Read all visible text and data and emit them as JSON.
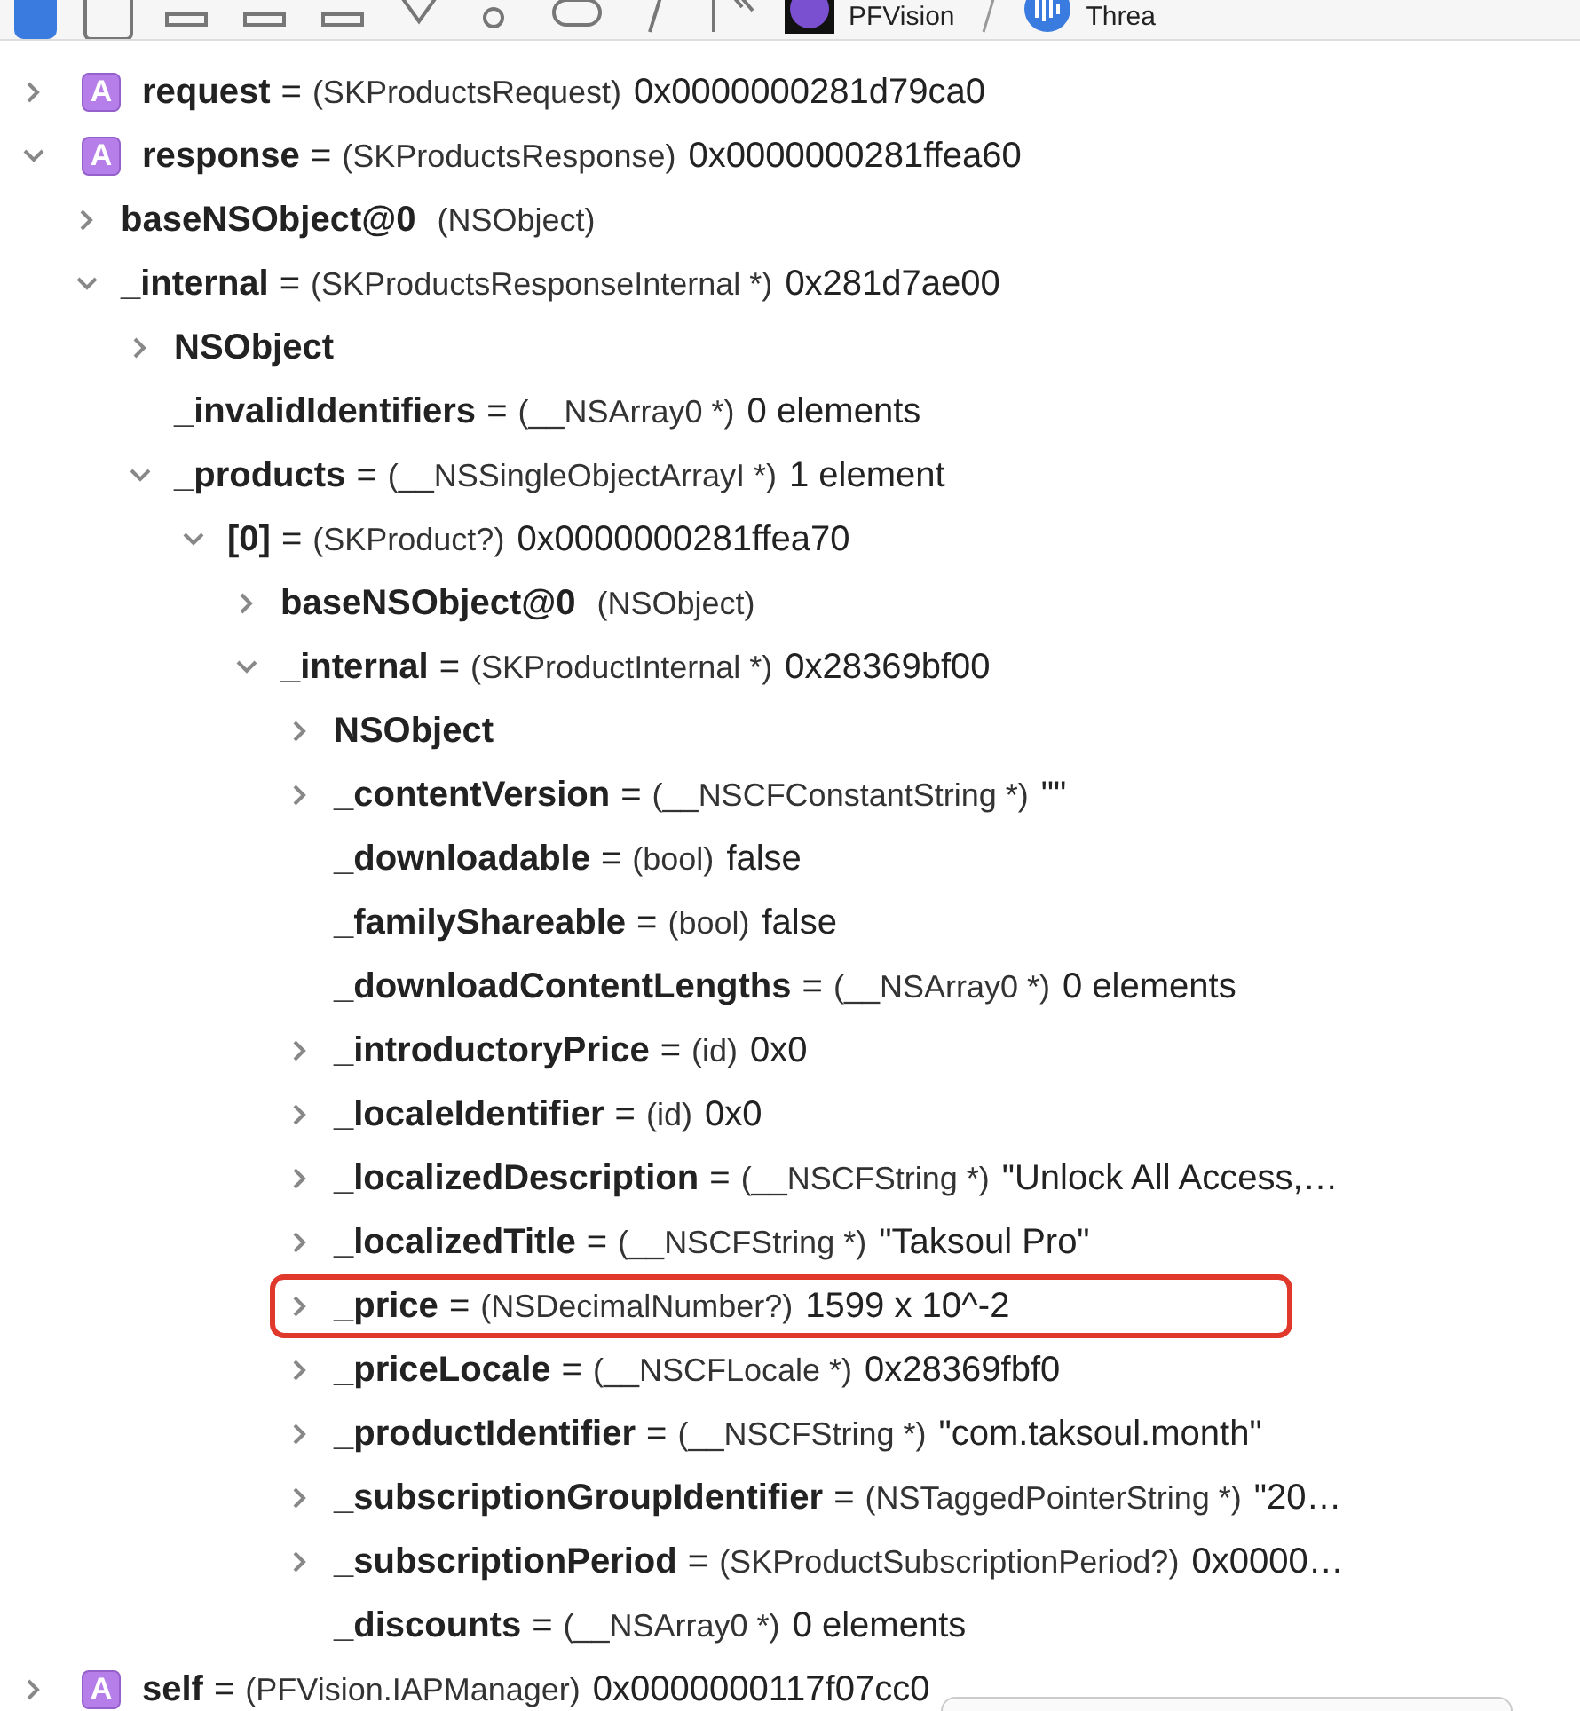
{
  "toolbar": {
    "breadcrumbs": [
      {
        "label": "PFVision"
      },
      {
        "label": "Threa"
      }
    ]
  },
  "variables": [
    {
      "kind": "group",
      "expanded": false,
      "highlighted": false,
      "badge": "A",
      "name": "request",
      "equals": "=",
      "type": "(SKProductsRequest)",
      "value": "0x0000000281d79ca0"
    },
    {
      "kind": "group",
      "expanded": true,
      "highlighted": false,
      "badge": "A",
      "name": "response",
      "equals": "=",
      "type": "(SKProductsResponse)",
      "value": "0x0000000281ffea60",
      "children": [
        {
          "kind": "group",
          "expanded": false,
          "highlighted": false,
          "name": "baseNSObject@0",
          "type": "(NSObject)"
        },
        {
          "kind": "group",
          "expanded": true,
          "highlighted": false,
          "name": "_internal",
          "equals": "=",
          "type": "(SKProductsResponseInternal *)",
          "value": "0x281d7ae00",
          "children": [
            {
              "kind": "group",
              "expanded": false,
              "highlighted": false,
              "name": "NSObject"
            },
            {
              "kind": "leaf",
              "highlighted": false,
              "name": "_invalidIdentifiers",
              "equals": "=",
              "type": "(__NSArray0 *)",
              "value": "0 elements"
            },
            {
              "kind": "group",
              "expanded": true,
              "highlighted": false,
              "name": "_products",
              "equals": "=",
              "type": "(__NSSingleObjectArrayI *)",
              "value": "1 element",
              "children": [
                {
                  "kind": "group",
                  "expanded": true,
                  "highlighted": false,
                  "name": "[0]",
                  "equals": "=",
                  "type": "(SKProduct?)",
                  "value": "0x0000000281ffea70",
                  "children": [
                    {
                      "kind": "group",
                      "expanded": false,
                      "highlighted": false,
                      "name": "baseNSObject@0",
                      "type": "(NSObject)"
                    },
                    {
                      "kind": "group",
                      "expanded": true,
                      "highlighted": false,
                      "name": "_internal",
                      "equals": "=",
                      "type": "(SKProductInternal *)",
                      "value": "0x28369bf00",
                      "children": [
                        {
                          "kind": "group",
                          "expanded": false,
                          "highlighted": false,
                          "name": "NSObject"
                        },
                        {
                          "kind": "group",
                          "expanded": false,
                          "highlighted": false,
                          "name": "_contentVersion",
                          "equals": "=",
                          "type": "(__NSCFConstantString *)",
                          "value": "\"\""
                        },
                        {
                          "kind": "leaf",
                          "highlighted": false,
                          "name": "_downloadable",
                          "equals": "=",
                          "type": "(bool)",
                          "value": "false"
                        },
                        {
                          "kind": "leaf",
                          "highlighted": false,
                          "name": "_familyShareable",
                          "equals": "=",
                          "type": "(bool)",
                          "value": "false"
                        },
                        {
                          "kind": "leaf",
                          "highlighted": false,
                          "name": "_downloadContentLengths",
                          "equals": "=",
                          "type": "(__NSArray0 *)",
                          "value": "0 elements"
                        },
                        {
                          "kind": "group",
                          "expanded": false,
                          "highlighted": false,
                          "name": "_introductoryPrice",
                          "equals": "=",
                          "type": "(id)",
                          "value": "0x0"
                        },
                        {
                          "kind": "group",
                          "expanded": false,
                          "highlighted": false,
                          "name": "_localeIdentifier",
                          "equals": "=",
                          "type": "(id)",
                          "value": "0x0"
                        },
                        {
                          "kind": "group",
                          "expanded": false,
                          "highlighted": false,
                          "name": "_localizedDescription",
                          "equals": "=",
                          "type": "(__NSCFString *)",
                          "value": "\"Unlock All Access,…"
                        },
                        {
                          "kind": "group",
                          "expanded": false,
                          "highlighted": false,
                          "name": "_localizedTitle",
                          "equals": "=",
                          "type": "(__NSCFString *)",
                          "value": "\"Taksoul Pro\""
                        },
                        {
                          "kind": "group",
                          "expanded": false,
                          "highlighted": true,
                          "name": "_price",
                          "equals": "=",
                          "type": "(NSDecimalNumber?)",
                          "value": "1599 x 10^-2"
                        },
                        {
                          "kind": "group",
                          "expanded": false,
                          "highlighted": false,
                          "name": "_priceLocale",
                          "equals": "=",
                          "type": "(__NSCFLocale *)",
                          "value": "0x28369fbf0"
                        },
                        {
                          "kind": "group",
                          "expanded": false,
                          "highlighted": false,
                          "name": "_productIdentifier",
                          "equals": "=",
                          "type": "(__NSCFString *)",
                          "value": "\"com.taksoul.month\""
                        },
                        {
                          "kind": "group",
                          "expanded": false,
                          "highlighted": false,
                          "name": "_subscriptionGroupIdentifier",
                          "equals": "=",
                          "type": "(NSTaggedPointerString *)",
                          "value": "\"20…"
                        },
                        {
                          "kind": "group",
                          "expanded": false,
                          "highlighted": false,
                          "name": "_subscriptionPeriod",
                          "equals": "=",
                          "type": "(SKProductSubscriptionPeriod?)",
                          "value": "0x0000…"
                        },
                        {
                          "kind": "leaf",
                          "highlighted": false,
                          "name": "_discounts",
                          "equals": "=",
                          "type": "(__NSArray0 *)",
                          "value": "0 elements"
                        }
                      ]
                    }
                  ]
                }
              ]
            }
          ]
        }
      ]
    },
    {
      "kind": "group",
      "expanded": false,
      "highlighted": false,
      "badge": "A",
      "name": "self",
      "equals": "=",
      "type": "(PFVision.IAPManager)",
      "value": "0x0000000117f07cc0"
    }
  ]
}
